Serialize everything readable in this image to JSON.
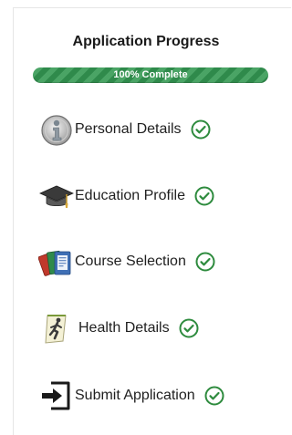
{
  "panel": {
    "title": "Application Progress",
    "progress": {
      "percent": 100,
      "label": "100% Complete",
      "bar_color": "#2f8a4b",
      "stripe_color": "#4aa465"
    }
  },
  "steps": [
    {
      "label": "Personal Details",
      "icon": "info-person-icon",
      "status": "complete"
    },
    {
      "label": "Education Profile",
      "icon": "graduation-cap-icon",
      "status": "complete"
    },
    {
      "label": "Course Selection",
      "icon": "course-books-icon",
      "status": "complete"
    },
    {
      "label": "Health Details",
      "icon": "runner-health-icon",
      "status": "complete"
    },
    {
      "label": "Submit Application",
      "icon": "submit-enter-icon",
      "status": "complete"
    }
  ],
  "colors": {
    "check_green": "#2e8b3e",
    "text": "#1f1f1f"
  }
}
